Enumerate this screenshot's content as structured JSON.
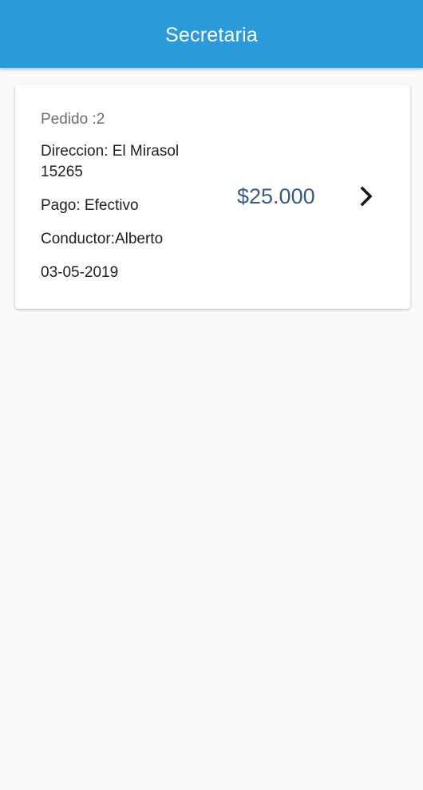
{
  "appbar": {
    "title": "Secretaria",
    "color": "#2a9ad9"
  },
  "order": {
    "id_label": "Pedido :2",
    "address_line1": "Direccion: El Mirasol",
    "address_line2": "15265",
    "payment": "Pago: Efectivo",
    "driver": "Conductor:Alberto",
    "date": "03-05-2019",
    "price": "$25.000",
    "price_color": "#3c5a80",
    "action_icon": "chevron-right-icon"
  }
}
